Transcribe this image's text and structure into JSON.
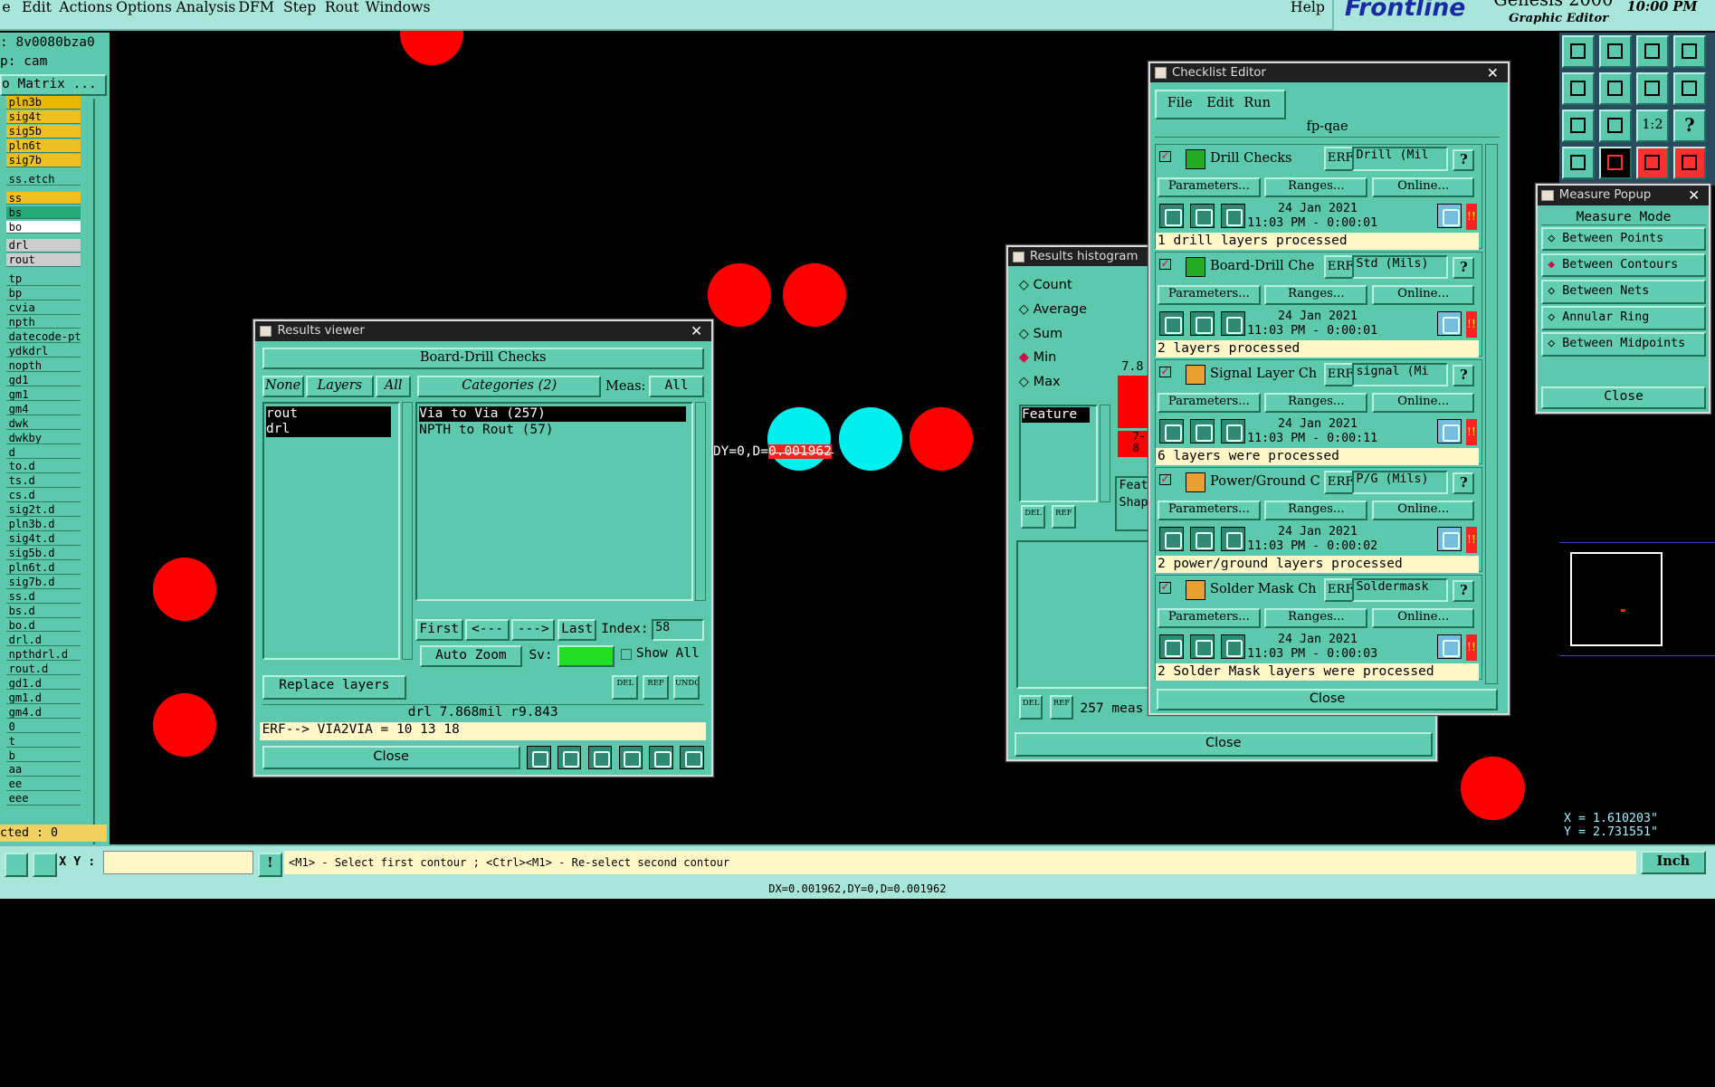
{
  "menus": [
    "e",
    "Edit",
    "Actions",
    "Options",
    "Analysis",
    "DFM",
    "Step",
    "Rout",
    "Windows"
  ],
  "help": "Help",
  "brand": {
    "name": "Frontline",
    "product": "Genesis 2000",
    "subtitle": "Graphic Editor",
    "time": "10:00 PM"
  },
  "left_panel": {
    "job": ": 8v0080bza0",
    "step": "p: cam",
    "matrix": "o Matrix ...",
    "layers": [
      "pln3b",
      "sig4t",
      "sig5b",
      "pln6t",
      "sig7b",
      "ss.etch",
      "ss",
      "bs",
      "bo",
      "drl",
      "rout",
      "tp",
      "bp",
      "cvia",
      "npth",
      "datecode-pt",
      "ydkdrl",
      "nopth",
      "gd1",
      "gm1",
      "gm4",
      "dwk",
      "dwkby",
      "d",
      "to.d",
      "ts.d",
      "cs.d",
      "sig2t.d",
      "pln3b.d",
      "sig4t.d",
      "sig5b.d",
      "pln6t.d",
      "sig7b.d",
      "ss.d",
      "bs.d",
      "bo.d",
      "drl.d",
      "npthdrl.d",
      "rout.d",
      "gd1.d",
      "gm1.d",
      "gm4.d",
      "0",
      "t",
      "b",
      "aa",
      "ee",
      "eee"
    ],
    "selected": "cted : 0"
  },
  "measure_text": {
    "prefix": "DY=0,D=",
    "value": "0.001962"
  },
  "results_viewer": {
    "title": "Results viewer",
    "heading": "Board-Drill Checks",
    "none": "None",
    "layers": "Layers",
    "all": "All",
    "categories": "Categories (2)",
    "meas": "Meas:",
    "meas_value": "All",
    "layer_list": [
      "rout",
      "drl"
    ],
    "category_list": [
      "Via to Via  (257)",
      "NPTH to Rout  (57)"
    ],
    "first": "First",
    "prev": "<---",
    "next": "--->",
    "last": "Last",
    "index": "Index:",
    "index_value": "58",
    "auto_zoom": "Auto Zoom",
    "sv": "Sv:",
    "show_all": "Show All",
    "replace_layers": "Replace layers",
    "info": "drl 7.868mil  r9.843",
    "erf": "ERF--> VIA2VIA = 10 13 18",
    "close": "Close",
    "del": "DEL",
    "ref": "REF",
    "undo": "UNDO"
  },
  "histogram": {
    "title": "Results histogram",
    "options": [
      "Count",
      "Average",
      "Sum",
      "Min",
      "Max"
    ],
    "selected": "Min",
    "feature": "Feature",
    "bar_label": "7.8",
    "bar2_label": "7-",
    "bar2_sub": "8",
    "feat": "Feat",
    "shap": "Shap",
    "status": "257 meas",
    "close": "Close",
    "del": "DEL",
    "ref": "REF"
  },
  "checklist": {
    "title": "Checklist Editor",
    "menu": [
      "File",
      "Edit",
      "Run"
    ],
    "name": "fp-qae",
    "params": "Parameters...",
    "ranges": "Ranges...",
    "online": "Online...",
    "erf": "ERF:",
    "items": [
      {
        "name": "Drill Checks",
        "erf": "Drill (Mil",
        "date": "24 Jan 2021",
        "time": "11:03 PM - 0:00:01",
        "status": "1 drill layers processed"
      },
      {
        "name": "Board-Drill Che",
        "erf": "Std (Mils)",
        "date": "24 Jan 2021",
        "time": "11:03 PM - 0:00:01",
        "status": "2 layers processed"
      },
      {
        "name": "Signal Layer Ch",
        "erf": "signal (Mi",
        "date": "24 Jan 2021",
        "time": "11:03 PM - 0:00:11",
        "status": "6 layers were processed"
      },
      {
        "name": "Power/Ground C",
        "erf": "P/G (Mils)",
        "date": "24 Jan 2021",
        "time": "11:03 PM - 0:00:02",
        "status": "2 power/ground layers processed"
      },
      {
        "name": "Solder Mask Ch",
        "erf": "Soldermask",
        "date": "24 Jan 2021",
        "time": "11:03 PM - 0:00:03",
        "status": "2 Solder Mask layers were processed"
      }
    ],
    "close": "Close"
  },
  "measure": {
    "title": "Measure Popup",
    "heading": "Measure Mode",
    "options": [
      "Between Points",
      "Between Contours",
      "Between Nets",
      "Annular Ring",
      "Between Midpoints"
    ],
    "selected": "Between Contours",
    "close": "Close"
  },
  "coords": {
    "x": "X = 1.610203\"",
    "y": "Y = 2.731551\""
  },
  "bottom": {
    "xy_label": "X Y :",
    "prompt": "<M1> - Select first contour ; <Ctrl><M1> - Re-select second contour",
    "units": "Inch",
    "status": "DX=0.001962,DY=0,D=0.001962"
  },
  "right_toolbar": {
    "scale": "1:2",
    "help": "?"
  },
  "colors": {
    "teal": "#5cc9ae",
    "red_pad": "#ff0000",
    "cyan_pad": "#00f0f0",
    "status_yellow": "#fff7c8",
    "menu_bg": "#a8e6dc"
  }
}
